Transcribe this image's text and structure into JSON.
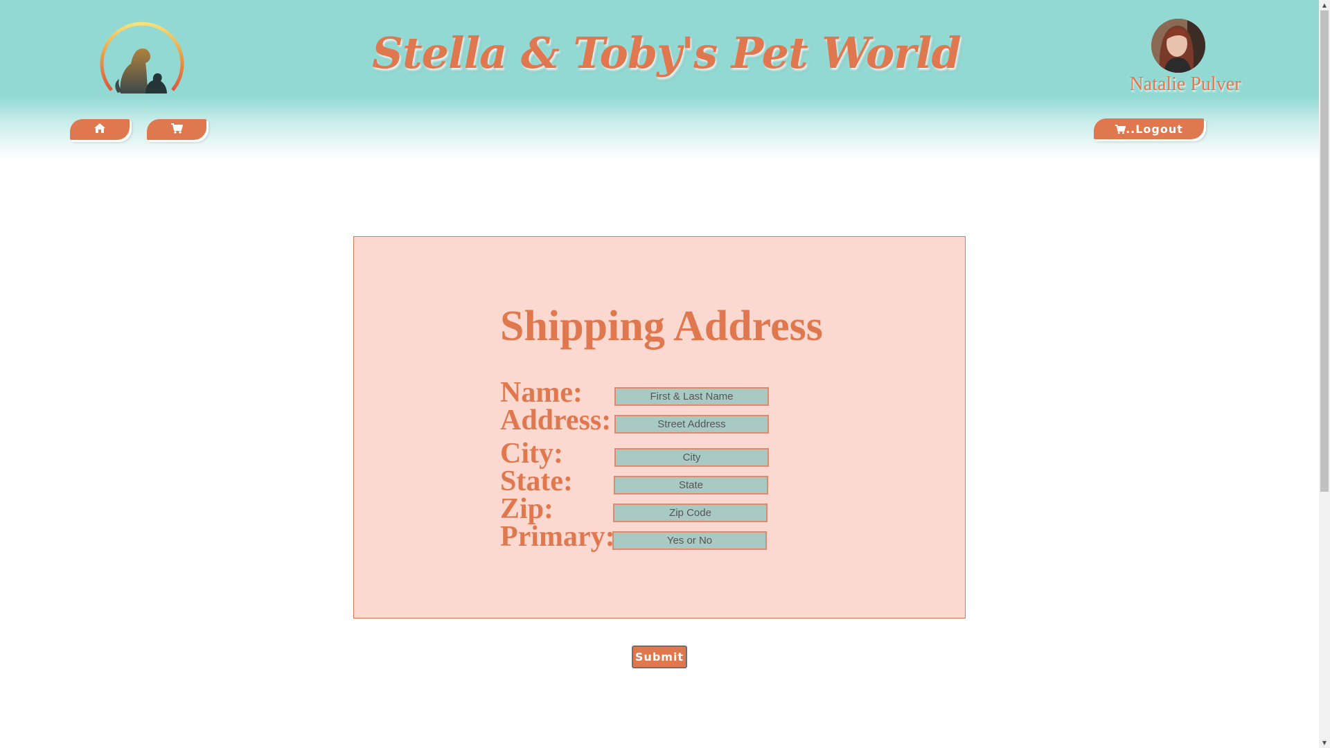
{
  "header": {
    "site_title": "Stella & Toby's Pet World",
    "logo_icon": "dog-and-cat-logo-icon",
    "user_name": "Natalie Pulver",
    "avatar_icon": "user-avatar"
  },
  "nav": {
    "home_icon": "home-icon",
    "cart_icon": "cart-icon",
    "logout_icon": "cart-icon",
    "logout_label": "..Logout"
  },
  "form": {
    "title": "Shipping Address",
    "fields": [
      {
        "label": "Name:",
        "placeholder": "First & Last Name",
        "value": ""
      },
      {
        "label": "Address:",
        "placeholder": "Street Address",
        "value": ""
      },
      {
        "label": "City:",
        "placeholder": "City",
        "value": ""
      },
      {
        "label": "State:",
        "placeholder": "State",
        "value": ""
      },
      {
        "label": "Zip:",
        "placeholder": "Zip Code",
        "value": ""
      },
      {
        "label": "Primary:",
        "placeholder": "Yes or No",
        "value": ""
      }
    ],
    "submit_label": "Submit"
  },
  "colors": {
    "accent": "#e0784f",
    "header_teal": "#93d9d3",
    "card_bg": "#fcd9d0",
    "input_bg": "#a9c9c3"
  }
}
